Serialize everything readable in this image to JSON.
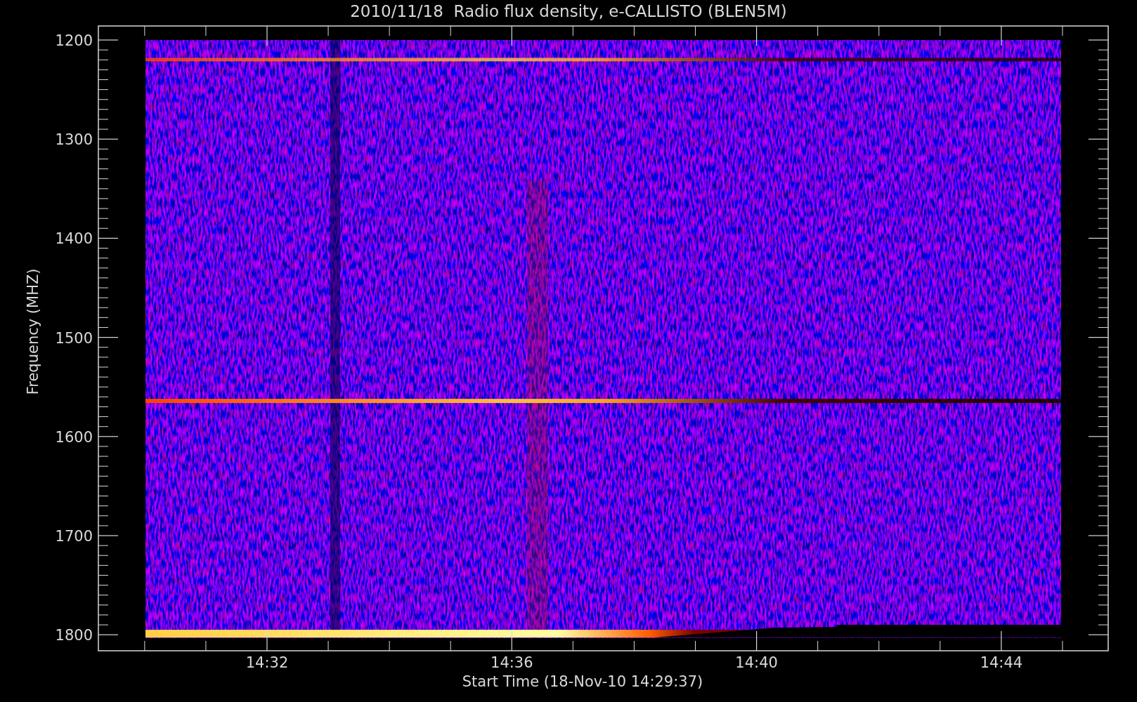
{
  "plot": {
    "title": "2010/11/18  Radio flux density, e-CALLISTO (BLEN5M)",
    "y_axis": {
      "label": "Frequency (MHZ)",
      "ticks": [
        "1200",
        "1300",
        "1400",
        "1500",
        "1600",
        "1700",
        "1800"
      ]
    },
    "x_axis": {
      "label": "Start Time (18-Nov-10 14:29:37)",
      "ticks": [
        "14:32",
        "14:36",
        "14:40",
        "14:44"
      ]
    }
  }
}
